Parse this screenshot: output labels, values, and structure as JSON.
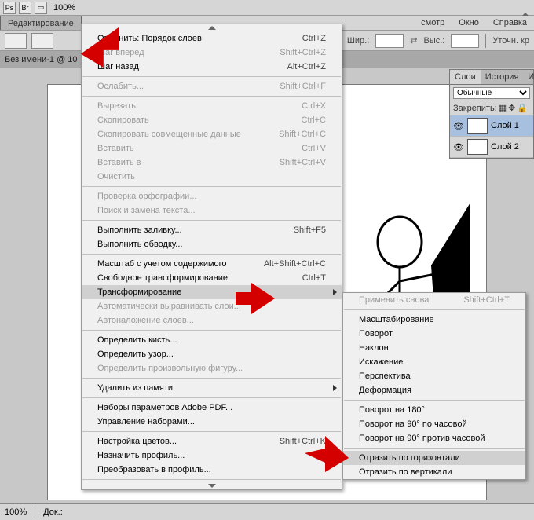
{
  "top": {
    "zoom": "100%"
  },
  "menu_bar": {
    "edit": "Редактирование",
    "view_partial": "смотр",
    "window": "Окно",
    "help": "Справка"
  },
  "options": {
    "width_label": "Шир.:",
    "height_label": "Выс.:",
    "refine": "Уточн. кр"
  },
  "doc_tab": "Без имени-1 @ 10",
  "edit_menu": {
    "undo": "Отменить: Порядок слоев",
    "undo_sc": "Ctrl+Z",
    "step_fwd": "Шаг вперед",
    "step_fwd_sc": "Shift+Ctrl+Z",
    "step_back": "Шаг назад",
    "step_back_sc": "Alt+Ctrl+Z",
    "fade": "Ослабить...",
    "fade_sc": "Shift+Ctrl+F",
    "cut": "Вырезать",
    "cut_sc": "Ctrl+X",
    "copy": "Скопировать",
    "copy_sc": "Ctrl+C",
    "copy_merged": "Скопировать совмещенные данные",
    "copy_merged_sc": "Shift+Ctrl+C",
    "paste": "Вставить",
    "paste_sc": "Ctrl+V",
    "paste_into": "Вставить в",
    "paste_into_sc": "Shift+Ctrl+V",
    "clear": "Очистить",
    "spell": "Проверка орфографии...",
    "find_replace": "Поиск и замена текста...",
    "fill": "Выполнить заливку...",
    "fill_sc": "Shift+F5",
    "stroke": "Выполнить обводку...",
    "content_scale": "Масштаб с учетом содержимого",
    "content_scale_sc": "Alt+Shift+Ctrl+C",
    "free_transform": "Свободное трансформирование",
    "free_transform_sc": "Ctrl+T",
    "transform": "Трансформирование",
    "auto_align": "Автоматически выравнивать слои...",
    "auto_blend": "Автоналожение слоев...",
    "define_brush": "Определить кисть...",
    "define_pattern": "Определить узор...",
    "define_shape": "Определить произвольную фигуру...",
    "purge": "Удалить из памяти",
    "pdf_presets": "Наборы параметров Adobe PDF...",
    "preset_manager": "Управление наборами...",
    "color_settings": "Настройка цветов...",
    "color_settings_sc": "Shift+Ctrl+K",
    "assign_profile": "Назначить профиль...",
    "convert_profile": "Преобразовать в профиль..."
  },
  "transform_menu": {
    "again": "Применить снова",
    "again_sc": "Shift+Ctrl+T",
    "scale": "Масштабирование",
    "rotate": "Поворот",
    "skew": "Наклон",
    "distort": "Искажение",
    "perspective": "Перспектива",
    "warp": "Деформация",
    "r180": "Поворот на 180°",
    "r90cw": "Поворот на 90° по часовой",
    "r90ccw": "Поворот на 90° против часовой",
    "flip_h": "Отразить по горизонтали",
    "flip_v": "Отразить по вертикали"
  },
  "layers_panel": {
    "tabs": {
      "layers": "Слои",
      "history": "История",
      "i": "И"
    },
    "blend": "Обычные",
    "lock_label": "Закрепить:",
    "layer1": "Слой 1",
    "layer2": "Слой 2"
  },
  "status": {
    "zoom": "100%",
    "doc": "Док.:"
  }
}
